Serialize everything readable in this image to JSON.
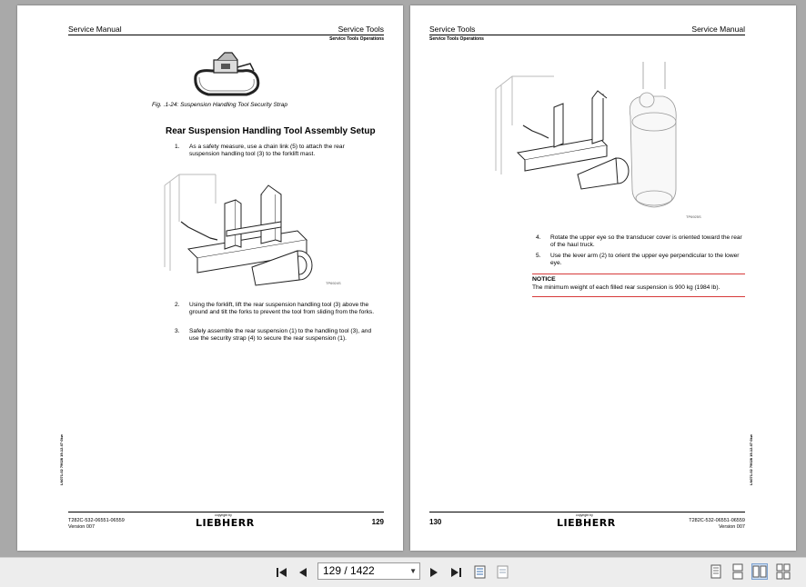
{
  "left_page": {
    "header_left": "Service Manual",
    "header_right": "Service Tools",
    "header_sub": "Service Tools Operations",
    "figure_caption": "Fig. .1-24: Suspension Handling Tool Security Strap",
    "section_title": "Rear Suspension Handling Tool Assembly Setup",
    "steps": [
      {
        "num": "1.",
        "text": "As a safety measure, use a chain link (5) to attach the rear suspension handling tool (3) to the forklift mast."
      },
      {
        "num": "2.",
        "text": "Using the forklift, lift the rear suspension handling tool (3) above the ground and tilt the forks to prevent the tool from sliding from the forks."
      },
      {
        "num": "3.",
        "text": "Safely assemble the rear suspension (1) to the handling tool (3), and use the security strap (4) to secure the rear suspension (1)."
      }
    ],
    "figure_tag": "TP6924S",
    "side_code": "LN071-02 79028 19-12-07 0kw",
    "footer_doc": "T282C-532-06551-06559",
    "footer_version": "Version 007",
    "copyright": "copyright by",
    "logo": "LIEBHERR",
    "page_number": "129"
  },
  "right_page": {
    "header_left": "Service Tools",
    "header_right": "Service Manual",
    "header_sub": "Service Tools Operations",
    "figure_tag": "TP6925S",
    "steps": [
      {
        "num": "4.",
        "text": "Rotate the upper eye so the transducer cover is oriented toward the rear of the haul truck."
      },
      {
        "num": "5.",
        "text": "Use the lever arm (2) to orient the upper eye perpendicular to the lower eye."
      }
    ],
    "notice_title": "NOTICE",
    "notice_text": "The minimum weight of each filled rear suspension is 900 kg (1984 lb).",
    "side_code": "LN071-02 79028 19-12-07 0kw",
    "footer_doc": "T282C-532-06551-06559",
    "footer_version": "Version 007",
    "copyright": "copyright by",
    "logo": "LIEBHERR",
    "page_number": "130"
  },
  "toolbar": {
    "page_indicator": "129 / 1422",
    "icons": [
      "first-page-icon",
      "previous-page-icon",
      "next-page-icon",
      "last-page-icon",
      "fit-page-icon",
      "fit-width-icon",
      "single-page-view-icon",
      "continuous-view-icon",
      "two-page-view-icon",
      "two-page-continuous-view-icon"
    ]
  },
  "colors": {
    "background": "#a9a9a9",
    "page": "#ffffff",
    "notice_rule": "#d73a3a",
    "toolbar": "#ededed"
  }
}
